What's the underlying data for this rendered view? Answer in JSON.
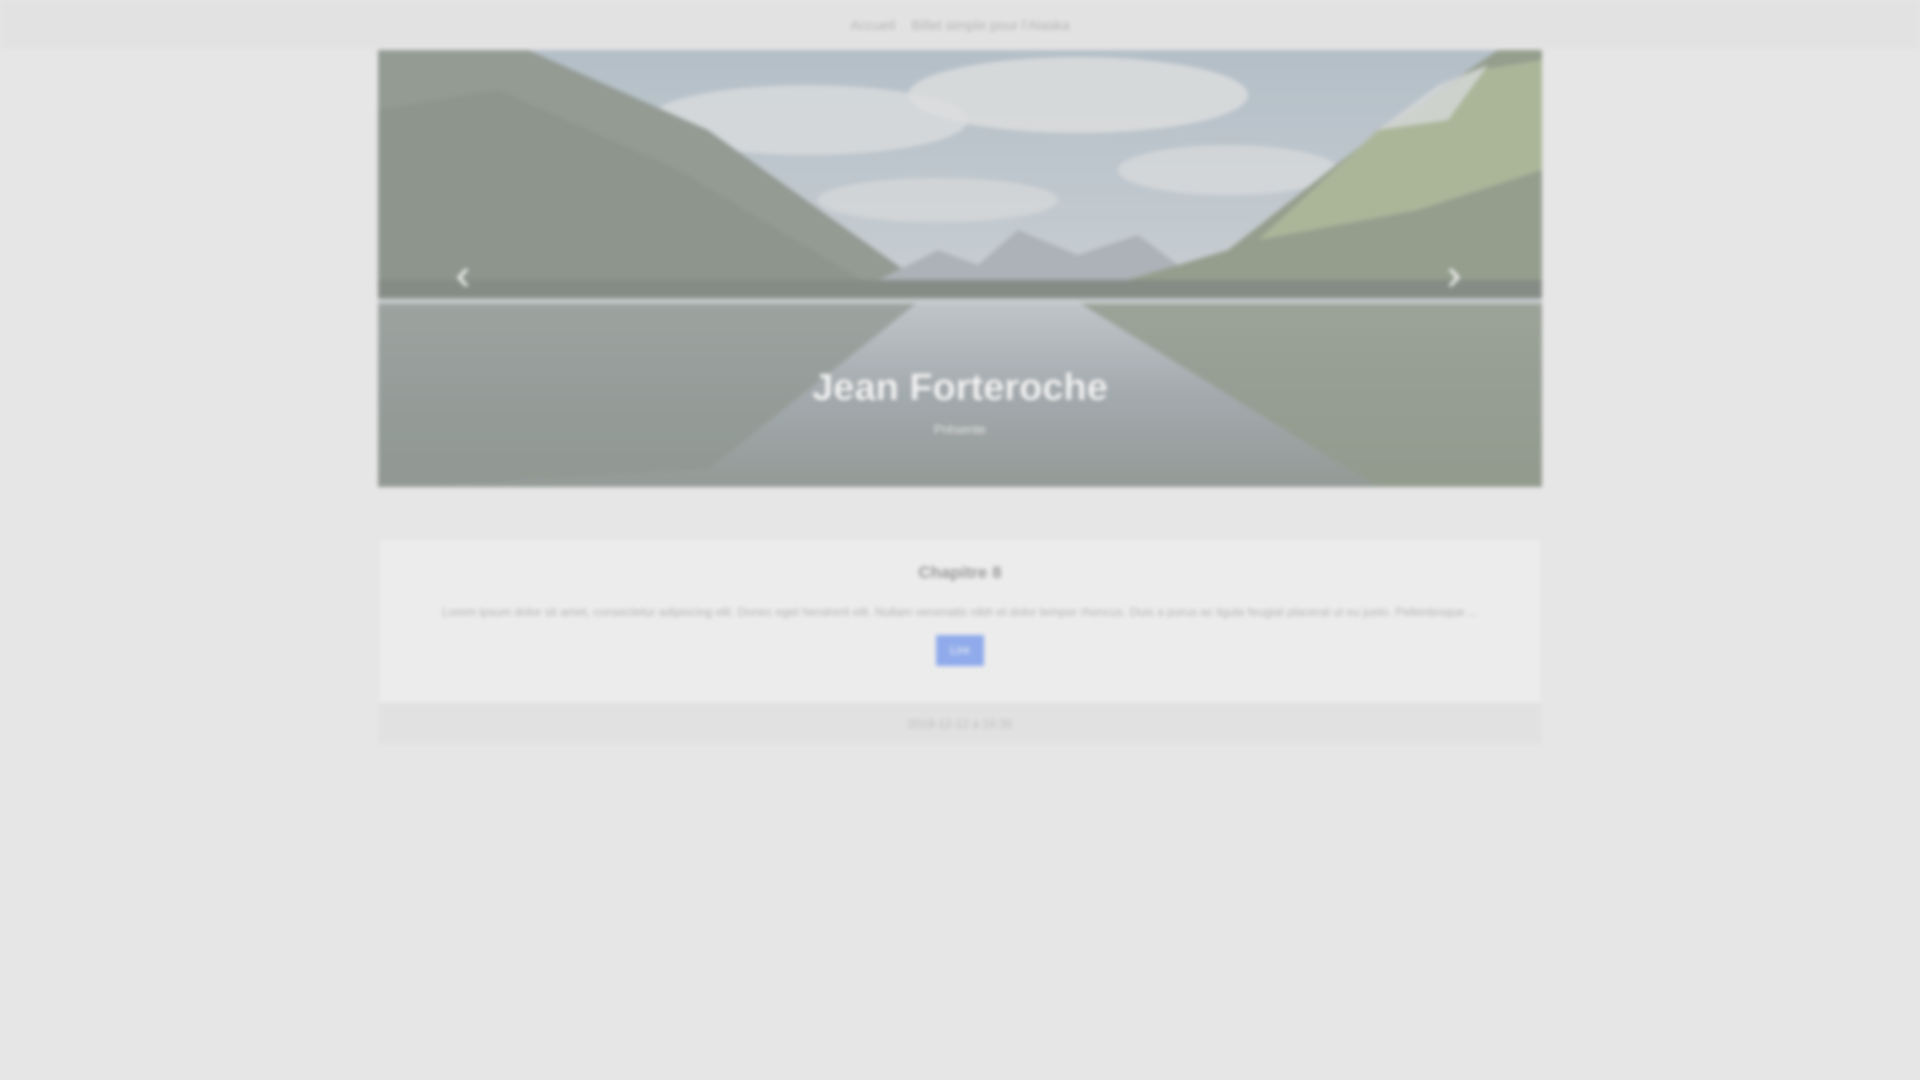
{
  "nav": {
    "links": [
      "Accueil",
      "Billet simple pour l'Alaska"
    ]
  },
  "carousel": {
    "title": "Jean Forteroche",
    "subtitle": "Présente",
    "prev_icon": "chevron-left-icon",
    "next_icon": "chevron-right-icon"
  },
  "chapter": {
    "title": "Chapitre 8",
    "excerpt": "Lorem ipsum dolor sit amet, consectetur adipiscing elit. Donec eget hendrerit elit. Nullam venenatis nibh et dolor tempor rhoncus. Duis a purus ac ligula feugiat placerat ut eu justo. Pellentesque ...",
    "button_label": "Lire",
    "footer": "2018-12-12 à 16:35"
  },
  "colors": {
    "background": "#e6e6e6",
    "button": "#4a7cf0"
  }
}
